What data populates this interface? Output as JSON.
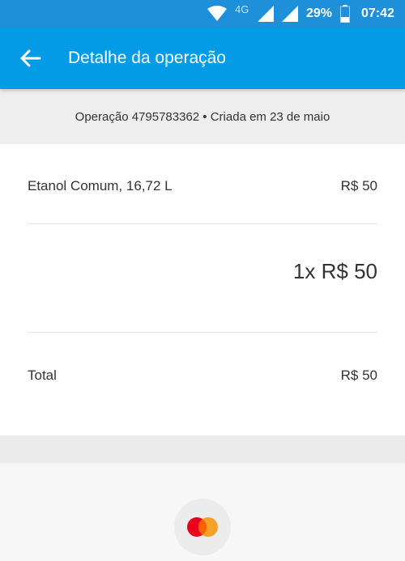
{
  "status_bar": {
    "network": "4G",
    "battery": "29%",
    "time": "07:42"
  },
  "header": {
    "title": "Detalhe da operação",
    "back_icon": "arrow-left-icon"
  },
  "operation": {
    "summary": "Operação 4795783362 • Criada em 23 de maio"
  },
  "item": {
    "description": "Etanol Comum, 16,72 L",
    "amount": "R$ 50"
  },
  "installments": {
    "text": "1x R$ 50"
  },
  "total": {
    "label": "Total",
    "amount": "R$ 50"
  },
  "payment": {
    "method_icon": "mastercard-icon"
  },
  "colors": {
    "status_bar": "#1e8fd9",
    "app_bar": "#039be5",
    "mastercard_red": "#eb001b",
    "mastercard_orange": "#f79e1b"
  }
}
